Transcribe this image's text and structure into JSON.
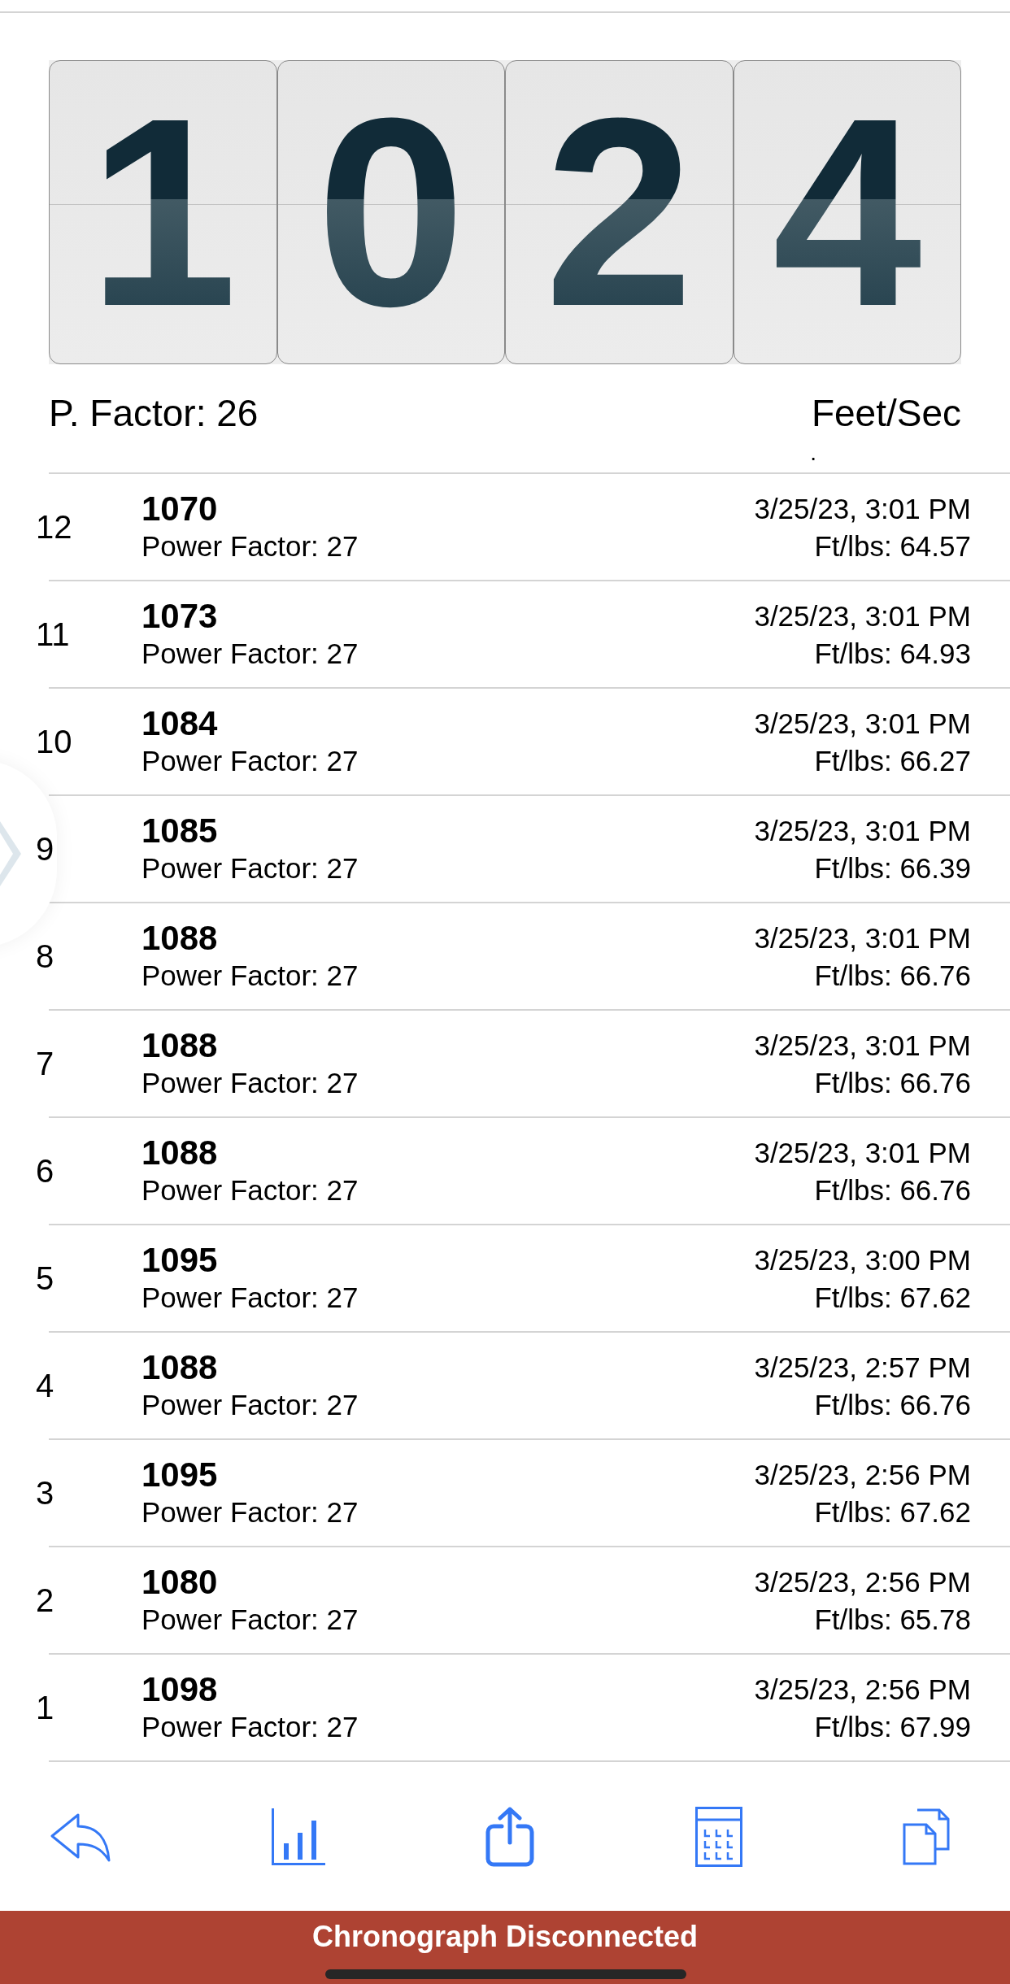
{
  "display": {
    "digits": [
      "1",
      "0",
      "2",
      "4"
    ]
  },
  "power_factor_label": "P. Factor: 26",
  "unit_label": "Feet/Sec",
  "mark": ".",
  "shots": [
    {
      "number": "12",
      "velocity": "1070",
      "power_factor": "Power Factor: 27",
      "time": "3/25/23, 3:01 PM",
      "energy": "Ft/lbs: 64.57"
    },
    {
      "number": "11",
      "velocity": "1073",
      "power_factor": "Power Factor: 27",
      "time": "3/25/23, 3:01 PM",
      "energy": "Ft/lbs: 64.93"
    },
    {
      "number": "10",
      "velocity": "1084",
      "power_factor": "Power Factor: 27",
      "time": "3/25/23, 3:01 PM",
      "energy": "Ft/lbs: 66.27"
    },
    {
      "number": "9",
      "velocity": "1085",
      "power_factor": "Power Factor: 27",
      "time": "3/25/23, 3:01 PM",
      "energy": "Ft/lbs: 66.39"
    },
    {
      "number": "8",
      "velocity": "1088",
      "power_factor": "Power Factor: 27",
      "time": "3/25/23, 3:01 PM",
      "energy": "Ft/lbs: 66.76"
    },
    {
      "number": "7",
      "velocity": "1088",
      "power_factor": "Power Factor: 27",
      "time": "3/25/23, 3:01 PM",
      "energy": "Ft/lbs: 66.76"
    },
    {
      "number": "6",
      "velocity": "1088",
      "power_factor": "Power Factor: 27",
      "time": "3/25/23, 3:01 PM",
      "energy": "Ft/lbs: 66.76"
    },
    {
      "number": "5",
      "velocity": "1095",
      "power_factor": "Power Factor: 27",
      "time": "3/25/23, 3:00 PM",
      "energy": "Ft/lbs: 67.62"
    },
    {
      "number": "4",
      "velocity": "1088",
      "power_factor": "Power Factor: 27",
      "time": "3/25/23, 2:57 PM",
      "energy": "Ft/lbs: 66.76"
    },
    {
      "number": "3",
      "velocity": "1095",
      "power_factor": "Power Factor: 27",
      "time": "3/25/23, 2:56 PM",
      "energy": "Ft/lbs: 67.62"
    },
    {
      "number": "2",
      "velocity": "1080",
      "power_factor": "Power Factor: 27",
      "time": "3/25/23, 2:56 PM",
      "energy": "Ft/lbs: 65.78"
    },
    {
      "number": "1",
      "velocity": "1098",
      "power_factor": "Power Factor: 27",
      "time": "3/25/23, 2:56 PM",
      "energy": "Ft/lbs: 67.99"
    }
  ],
  "toolbar": [
    {
      "kind": "back"
    },
    {
      "kind": "chart"
    },
    {
      "kind": "share"
    },
    {
      "kind": "calculator"
    },
    {
      "kind": "copy"
    }
  ],
  "status_banner": "Chronograph Disconnected"
}
